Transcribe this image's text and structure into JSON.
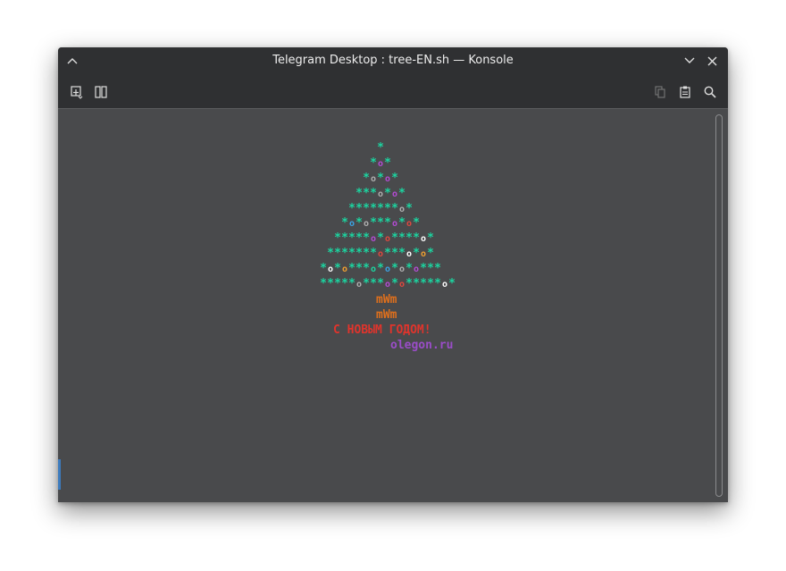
{
  "window": {
    "title": "Telegram Desktop : tree-EN.sh — Konsole"
  },
  "icons": {
    "titlebar_left": "chevron-up-icon",
    "titlebar_right": [
      "chevron-down-icon",
      "close-icon"
    ],
    "toolbar_left": [
      "new-tab-icon",
      "split-view-icon"
    ],
    "toolbar_right": [
      "copy-icon",
      "paste-icon",
      "search-icon"
    ]
  },
  "terminal": {
    "tree_rows": [
      "        *",
      "       *o*",
      "      *o*o*",
      "     ***o*o*",
      "    *******o*",
      "   *o*o***o*o*",
      "  *****o*o****o*",
      " *******o***o*o*",
      "*o*o***o*o*o*o***",
      "*****o***o*o*****o*"
    ],
    "trunk": [
      "mWm",
      "mWm"
    ],
    "greeting": "С НОВЫМ ГОДОМ!",
    "site": "olegon.ru"
  },
  "colors": {
    "background": "#494a4c",
    "titlebar": "#2f3032",
    "star": "#1bd6a1",
    "ornament_white": "#ffffff",
    "ornament_magenta": "#b54bd6",
    "ornament_blue": "#3aa3e6",
    "ornament_orange": "#f0a030",
    "ornament_red": "#e0483f",
    "ornament_gray": "#b0b0b0",
    "trunk": "#e0701c",
    "greeting": "#e0342c",
    "site": "#9a4dc8"
  }
}
